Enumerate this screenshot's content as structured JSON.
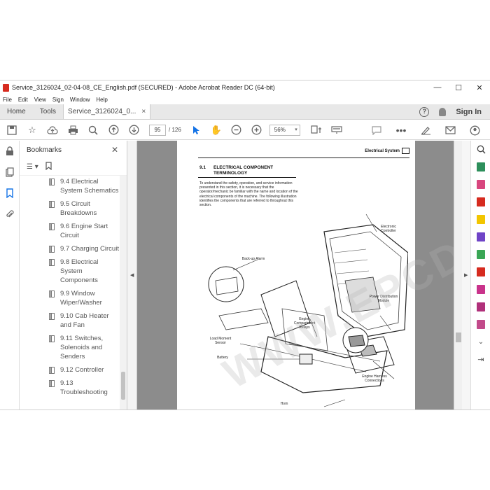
{
  "window": {
    "title": "Service_3126024_02-04-08_CE_English.pdf (SECURED) - Adobe Acrobat Reader DC (64-bit)",
    "controls": [
      "—",
      "☐",
      "✕"
    ]
  },
  "menu": [
    "File",
    "Edit",
    "View",
    "Sign",
    "Window",
    "Help"
  ],
  "tabs": {
    "home": "Home",
    "tools": "Tools",
    "document": "Service_3126024_0...",
    "close": "×",
    "sign_in": "Sign In"
  },
  "toolbar": {
    "page_current": "95",
    "page_separator_total": "/ 126",
    "zoom": "56%"
  },
  "bookmarks": {
    "title": "Bookmarks",
    "close": "✕",
    "items": [
      {
        "label": "9.4 Electrical System Schematics"
      },
      {
        "label": "9.5 Circuit Breakdowns"
      },
      {
        "label": "9.6 Engine Start Circuit"
      },
      {
        "label": "9.7 Charging Circuit"
      },
      {
        "label": "9.8 Electrical System Components"
      },
      {
        "label": "9.9 Window Wiper/Washer"
      },
      {
        "label": "9.10 Cab Heater and Fan"
      },
      {
        "label": "9.11 Switches, Solenoids and Senders"
      },
      {
        "label": "9.12 Controller"
      },
      {
        "label": "9.13 Troubleshooting"
      }
    ]
  },
  "document": {
    "header": "Electrical System",
    "section_number": "9.1",
    "section_title": "ELECTRICAL COMPONENT TERMINOLOGY",
    "body": "To understand the safety, operation, and service information presented in this section, it is necessary that the operator/mechanic be familiar with the name and location of the electrical components of the machine. The following illustration identifies the components that are referred to throughout this section.",
    "labels": {
      "electronic_controller": "Electronic Controller",
      "backup_alarm": "Back-up Alarm",
      "power_distribution": "Power Distribution Module",
      "engine_relays": "Engine Compartment Relays",
      "load_moment": "Load Moment Sensor",
      "battery": "Battery",
      "engine_harness": "Engine Harness Connections",
      "horn": "Horn"
    },
    "watermark": "WWW.EPCDEPO.COM"
  },
  "colors": {
    "accent": "#1473e6",
    "pdf_red": "#d62b1f",
    "doc_background": "#8c8c8c"
  }
}
